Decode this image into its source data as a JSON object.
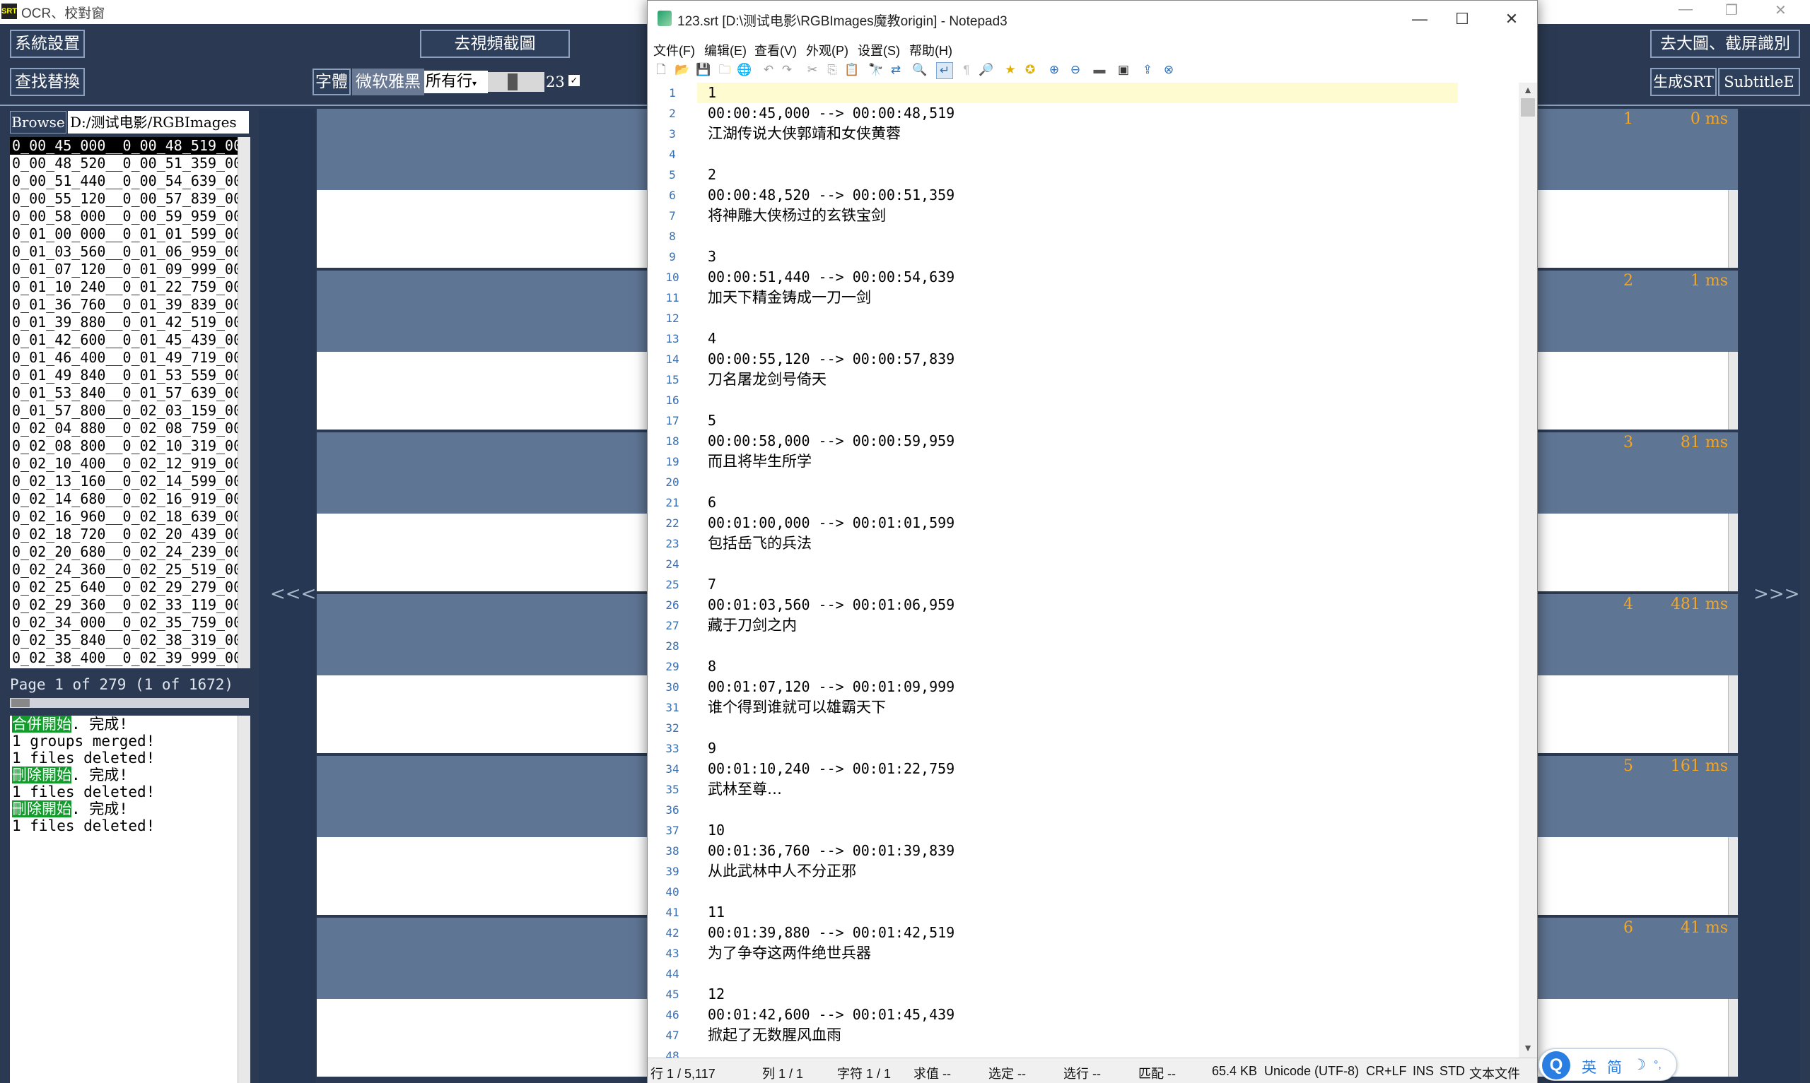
{
  "ocr_window": {
    "title": "OCR、校對窗",
    "app_icon_text": "SRT",
    "btn_settings": "系統設置",
    "btn_goto_video": "去視頻截圖",
    "btn_goto_bigimage": "去大圖、截屏識別",
    "btn_find_replace": "查找替換",
    "font_label": "字體",
    "font_name": "微软雅黑",
    "scope": "所有行",
    "font_size": "23",
    "btn_generate_srt": "生成SRT",
    "btn_subtitle_edit": "SubtitleE",
    "browse_label": "Browse",
    "path": "D:/测试电影/RGBImages",
    "files": [
      "0_00_45_000__0_00_48_519_00",
      "0_00_48_520__0_00_51_359_00",
      "0_00_51_440__0_00_54_639_00",
      "0_00_55_120__0_00_57_839_00",
      "0_00_58_000__0_00_59_959_00",
      "0_01_00_000__0_01_01_599_00",
      "0_01_03_560__0_01_06_959_00",
      "0_01_07_120__0_01_09_999_00",
      "0_01_10_240__0_01_22_759_00",
      "0_01_36_760__0_01_39_839_00",
      "0_01_39_880__0_01_42_519_00",
      "0_01_42_600__0_01_45_439_00",
      "0_01_46_400__0_01_49_719_00",
      "0_01_49_840__0_01_53_559_00",
      "0_01_53_840__0_01_57_639_00",
      "0_01_57_800__0_02_03_159_00",
      "0_02_04_880__0_02_08_759_00",
      "0_02_08_800__0_02_10_319_00",
      "0_02_10_400__0_02_12_919_00",
      "0_02_13_160__0_02_14_599_00",
      "0_02_14_680__0_02_16_919_00",
      "0_02_16_960__0_02_18_639_00",
      "0_02_18_720__0_02_20_439_00",
      "0_02_20_680__0_02_24_239_00",
      "0_02_24_360__0_02_25_519_00",
      "0_02_25_640__0_02_29_279_00",
      "0_02_29_360__0_02_33_119_00",
      "0_02_34_000__0_02_35_759_00",
      "0_02_35_840__0_02_38_319_00",
      "0_02_38_400__0_02_39_999_00"
    ],
    "page_info": "Page 1 of 279 (1 of 1672)",
    "log": [
      {
        "hl": "合併開始",
        "rest": ". 完成!"
      },
      {
        "hl": "",
        "rest": "1 groups merged!"
      },
      {
        "hl": "",
        "rest": "1 files deleted!"
      },
      {
        "hl": "刪除開始",
        "rest": ". 完成!"
      },
      {
        "hl": "",
        "rest": "1 files deleted!"
      },
      {
        "hl": "刪除開始",
        "rest": ". 完成!"
      },
      {
        "hl": "",
        "rest": "1 files deleted!"
      }
    ],
    "prev_arrow": "<<<",
    "next_arrow": ">>>",
    "frames": [
      {
        "n": "1",
        "ms": "0 ms"
      },
      {
        "n": "2",
        "ms": "1 ms"
      },
      {
        "n": "3",
        "ms": "81 ms"
      },
      {
        "n": "4",
        "ms": "481 ms"
      },
      {
        "n": "5",
        "ms": "161 ms"
      },
      {
        "n": "6",
        "ms": "41 ms"
      }
    ]
  },
  "notepad": {
    "title": "123.srt [D:\\测试电影\\RGBImages魔教origin] - Notepad3",
    "menu": [
      "文件(F)",
      "编辑(E)",
      "查看(V)",
      "外观(P)",
      "设置(S)",
      "帮助(H)"
    ],
    "line_numbers": [
      "1",
      "2",
      "3",
      "4",
      "5",
      "6",
      "7",
      "8",
      "9",
      "10",
      "11",
      "12",
      "13",
      "14",
      "15",
      "16",
      "17",
      "18",
      "19",
      "20",
      "21",
      "22",
      "23",
      "24",
      "25",
      "26",
      "27",
      "28",
      "29",
      "30",
      "31",
      "32",
      "33",
      "34",
      "35",
      "36",
      "37",
      "38",
      "39",
      "40",
      "41",
      "42",
      "43",
      "44",
      "45",
      "46",
      "47",
      "48"
    ],
    "lines": [
      "1",
      "00:00:45,000 --> 00:00:48,519",
      "江湖传说大侠郭靖和女侠黄蓉",
      "",
      "2",
      "00:00:48,520 --> 00:00:51,359",
      "将神雕大侠杨过的玄铁宝剑",
      "",
      "3",
      "00:00:51,440 --> 00:00:54,639",
      "加天下精金铸成一刀一剑",
      "",
      "4",
      "00:00:55,120 --> 00:00:57,839",
      "刀名屠龙剑号倚天",
      "",
      "5",
      "00:00:58,000 --> 00:00:59,959",
      "而且将毕生所学",
      "",
      "6",
      "00:01:00,000 --> 00:01:01,599",
      "包括岳飞的兵法",
      "",
      "7",
      "00:01:03,560 --> 00:01:06,959",
      "藏于刀剑之内",
      "",
      "8",
      "00:01:07,120 --> 00:01:09,999",
      "谁个得到谁就可以雄霸天下",
      "",
      "9",
      "00:01:10,240 --> 00:01:22,759",
      "武林至尊…",
      "",
      "10",
      "00:01:36,760 --> 00:01:39,839",
      "从此武林中人不分正邪",
      "",
      "11",
      "00:01:39,880 --> 00:01:42,519",
      "为了争夺这两件绝世兵器",
      "",
      "12",
      "00:01:42,600 --> 00:01:45,439",
      "掀起了无数腥风血雨",
      ""
    ],
    "status": {
      "line": "行 1 / 5,117",
      "col": "列 1 / 1",
      "char": "字符 1 / 1",
      "value": "求值 --",
      "sel": "选定 --",
      "selline": "选行 --",
      "match": "匹配 --",
      "size": "65.4 KB",
      "encoding": "Unicode (UTF-8)",
      "eol": "CR+LF",
      "ins": "INS",
      "std": "STD",
      "type": "文本文件"
    }
  },
  "ime": {
    "logo": "Q",
    "lang": "英",
    "mode": "简",
    "moon": "☽",
    "punct": "°,"
  }
}
